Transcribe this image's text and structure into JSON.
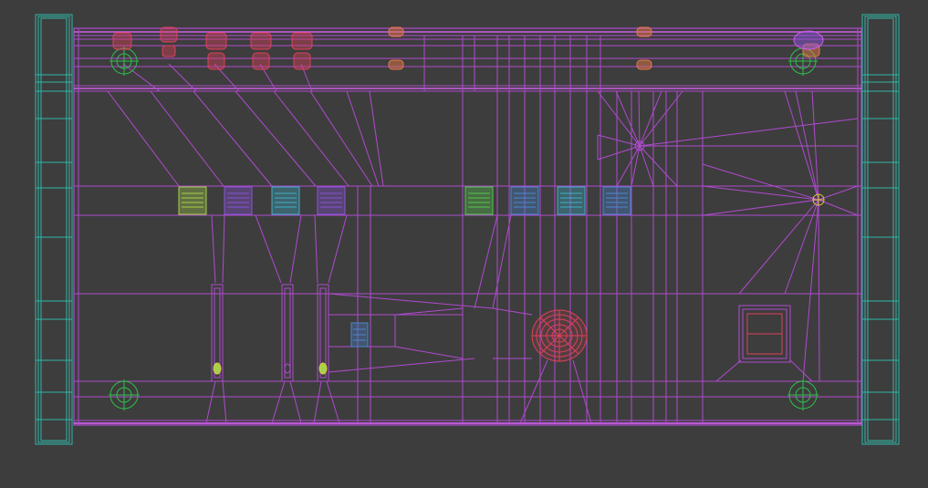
{
  "viewport": {
    "background": "#3d3d3d",
    "colors": {
      "frame_rail": "#2fb8a8",
      "wire_main": "#b04ad0",
      "wire_bright": "#cf5ee8",
      "socket_red": "#e0405a",
      "socket_orange": "#e47848",
      "vent_lime": "#a6d24a",
      "vent_purple": "#8a52d8",
      "vent_cyan": "#3eb0c8",
      "vent_blue": "#4a88d0",
      "vent_green": "#58c850",
      "gizmo_green": "#2fbf4a",
      "speaker_red": "#e0405a",
      "fixture_yellow": "#d8c840"
    },
    "icons": [
      "left-frame-rail",
      "right-frame-rail",
      "wall-outline",
      "wire-mesh",
      "vent-grille",
      "ceiling-fixture",
      "speaker-grille",
      "access-panel",
      "light-gizmo",
      "wall-socket"
    ]
  }
}
